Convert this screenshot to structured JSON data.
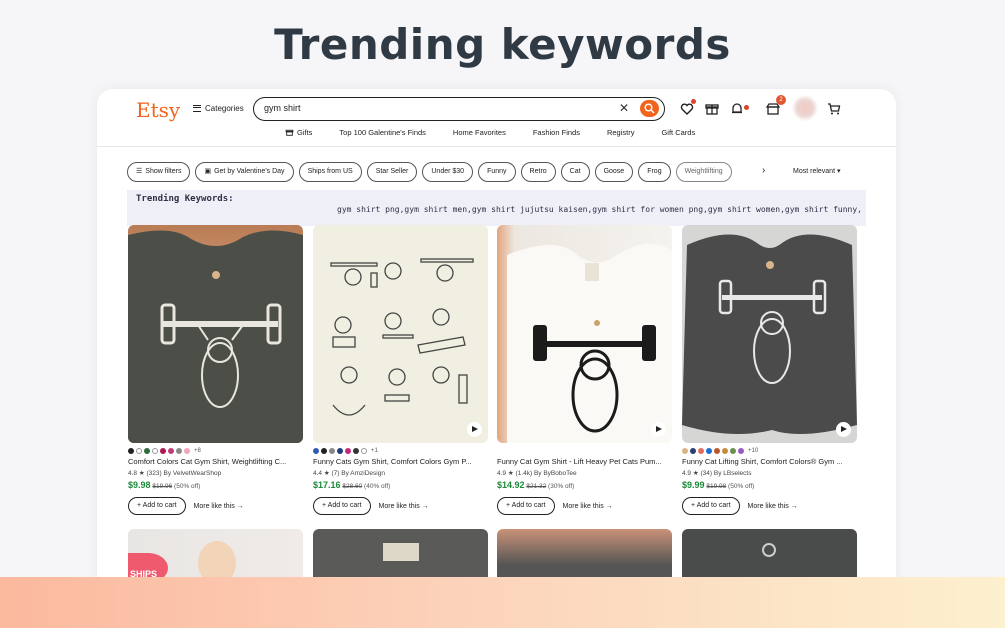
{
  "headline": "Trending keywords",
  "header": {
    "logo": "Etsy",
    "categories_label": "Categories",
    "search_value": "gym shirt",
    "cart_badge": "2"
  },
  "subnav": [
    "Gifts",
    "Top 100 Galentine's Finds",
    "Home Favorites",
    "Fashion Finds",
    "Registry",
    "Gift Cards"
  ],
  "filters": {
    "show_filters": "Show filters",
    "chips": [
      "Get by Valentine's Day",
      "Ships from US",
      "Star Seller",
      "Under $30",
      "Funny",
      "Retro",
      "Cat",
      "Goose",
      "Frog",
      "Weightlifting"
    ],
    "sort_label": "Most relevant"
  },
  "trending": {
    "label": "Trending Keywords:",
    "text": "gym shirt png,gym shirt men,gym shirt jujutsu kaisen,gym shirt for women png,gym shirt women,gym shirt funny,"
  },
  "products": [
    {
      "title": "Comfort Colors Cat Gym Shirt, Weightlifting C...",
      "rating": "4.8",
      "reviews": "(323)",
      "shop": "By VelvetWearShop",
      "price": "$9.98",
      "old_price": "$19.96",
      "discount": "(50% off)",
      "swatches": [
        "#222222",
        "#ffffff",
        "#2d6b3a",
        "#ffffff",
        "#b0174d",
        "#c23a7a",
        "#8a8a8a",
        "#f2a5b9"
      ],
      "more_colors": "+8",
      "add_to_cart": "Add to cart",
      "more_like": "More like this"
    },
    {
      "title": "Funny Cats Gym Shirt, Comfort Colors Gym P...",
      "rating": "4.4",
      "reviews": "(7)",
      "shop": "By AmziDesign",
      "price": "$17.16",
      "old_price": "$28.60",
      "discount": "(40% off)",
      "swatches": [
        "#2f5bb7",
        "#222222",
        "#888888",
        "#1e3d7a",
        "#c2297a",
        "#333333",
        "#ffffff"
      ],
      "more_colors": "+1",
      "add_to_cart": "Add to cart",
      "more_like": "More like this"
    },
    {
      "title": "Funny Cat Gym Shirt - Lift Heavy Pet Cats Pum...",
      "rating": "4.9",
      "reviews": "(1.4k)",
      "shop": "By ByBoboTee",
      "price": "$14.92",
      "old_price": "$21.32",
      "discount": "(30% off)",
      "swatches": [],
      "more_colors": "",
      "add_to_cart": "Add to cart",
      "more_like": "More like this"
    },
    {
      "title": "Funny Cat Lifting Shirt, Comfort Colors® Gym ...",
      "rating": "4.9",
      "reviews": "(34)",
      "shop": "By LBselects",
      "price": "$9.99",
      "old_price": "$19.98",
      "discount": "(50% off)",
      "swatches": [
        "#d9b48a",
        "#2d3f6e",
        "#e36b5e",
        "#1f6bd1",
        "#b7572d",
        "#c98a3a",
        "#6a8e4e",
        "#9a59c2"
      ],
      "more_colors": "+10",
      "add_to_cart": "Add to cart",
      "more_like": "More like this"
    }
  ],
  "promo_badge": "SHIPS"
}
